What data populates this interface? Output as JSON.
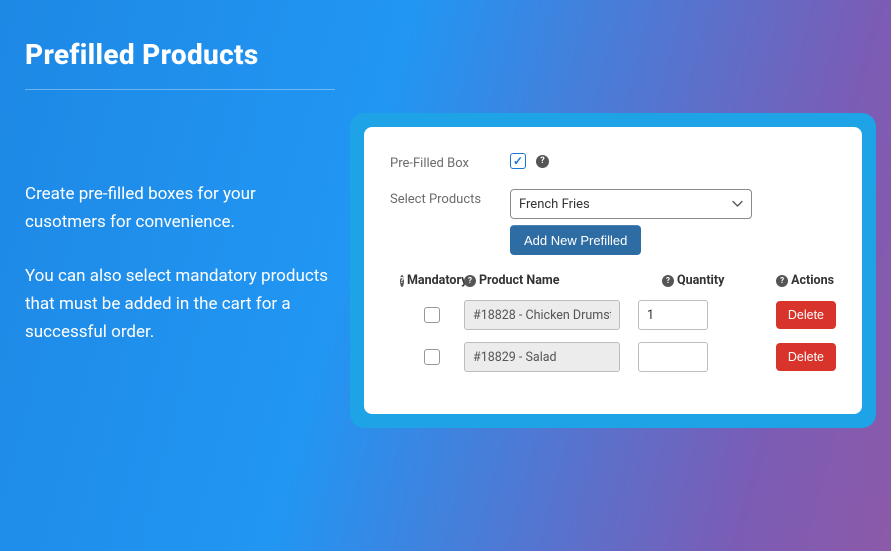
{
  "header": {
    "title": "Prefilled Products"
  },
  "description": {
    "p1": "Create pre-filled boxes for your cusotmers for convenience.",
    "p2": "You can also select mandatory products that must be added in the cart for a successful order."
  },
  "form": {
    "prefilled_label": "Pre-Filled Box",
    "prefilled_checked": true,
    "select_label": "Select Products",
    "select_value": "French Fries",
    "add_button": "Add New Prefilled"
  },
  "table": {
    "headers": {
      "mandatory": "Mandatory",
      "product_name": "Product Name",
      "quantity": "Quantity",
      "actions": "Actions"
    },
    "rows": [
      {
        "mandatory": false,
        "name": "#18828 - Chicken Drumst",
        "qty": "1",
        "action": "Delete"
      },
      {
        "mandatory": false,
        "name": "#18829 - Salad",
        "qty": "",
        "action": "Delete"
      }
    ]
  }
}
